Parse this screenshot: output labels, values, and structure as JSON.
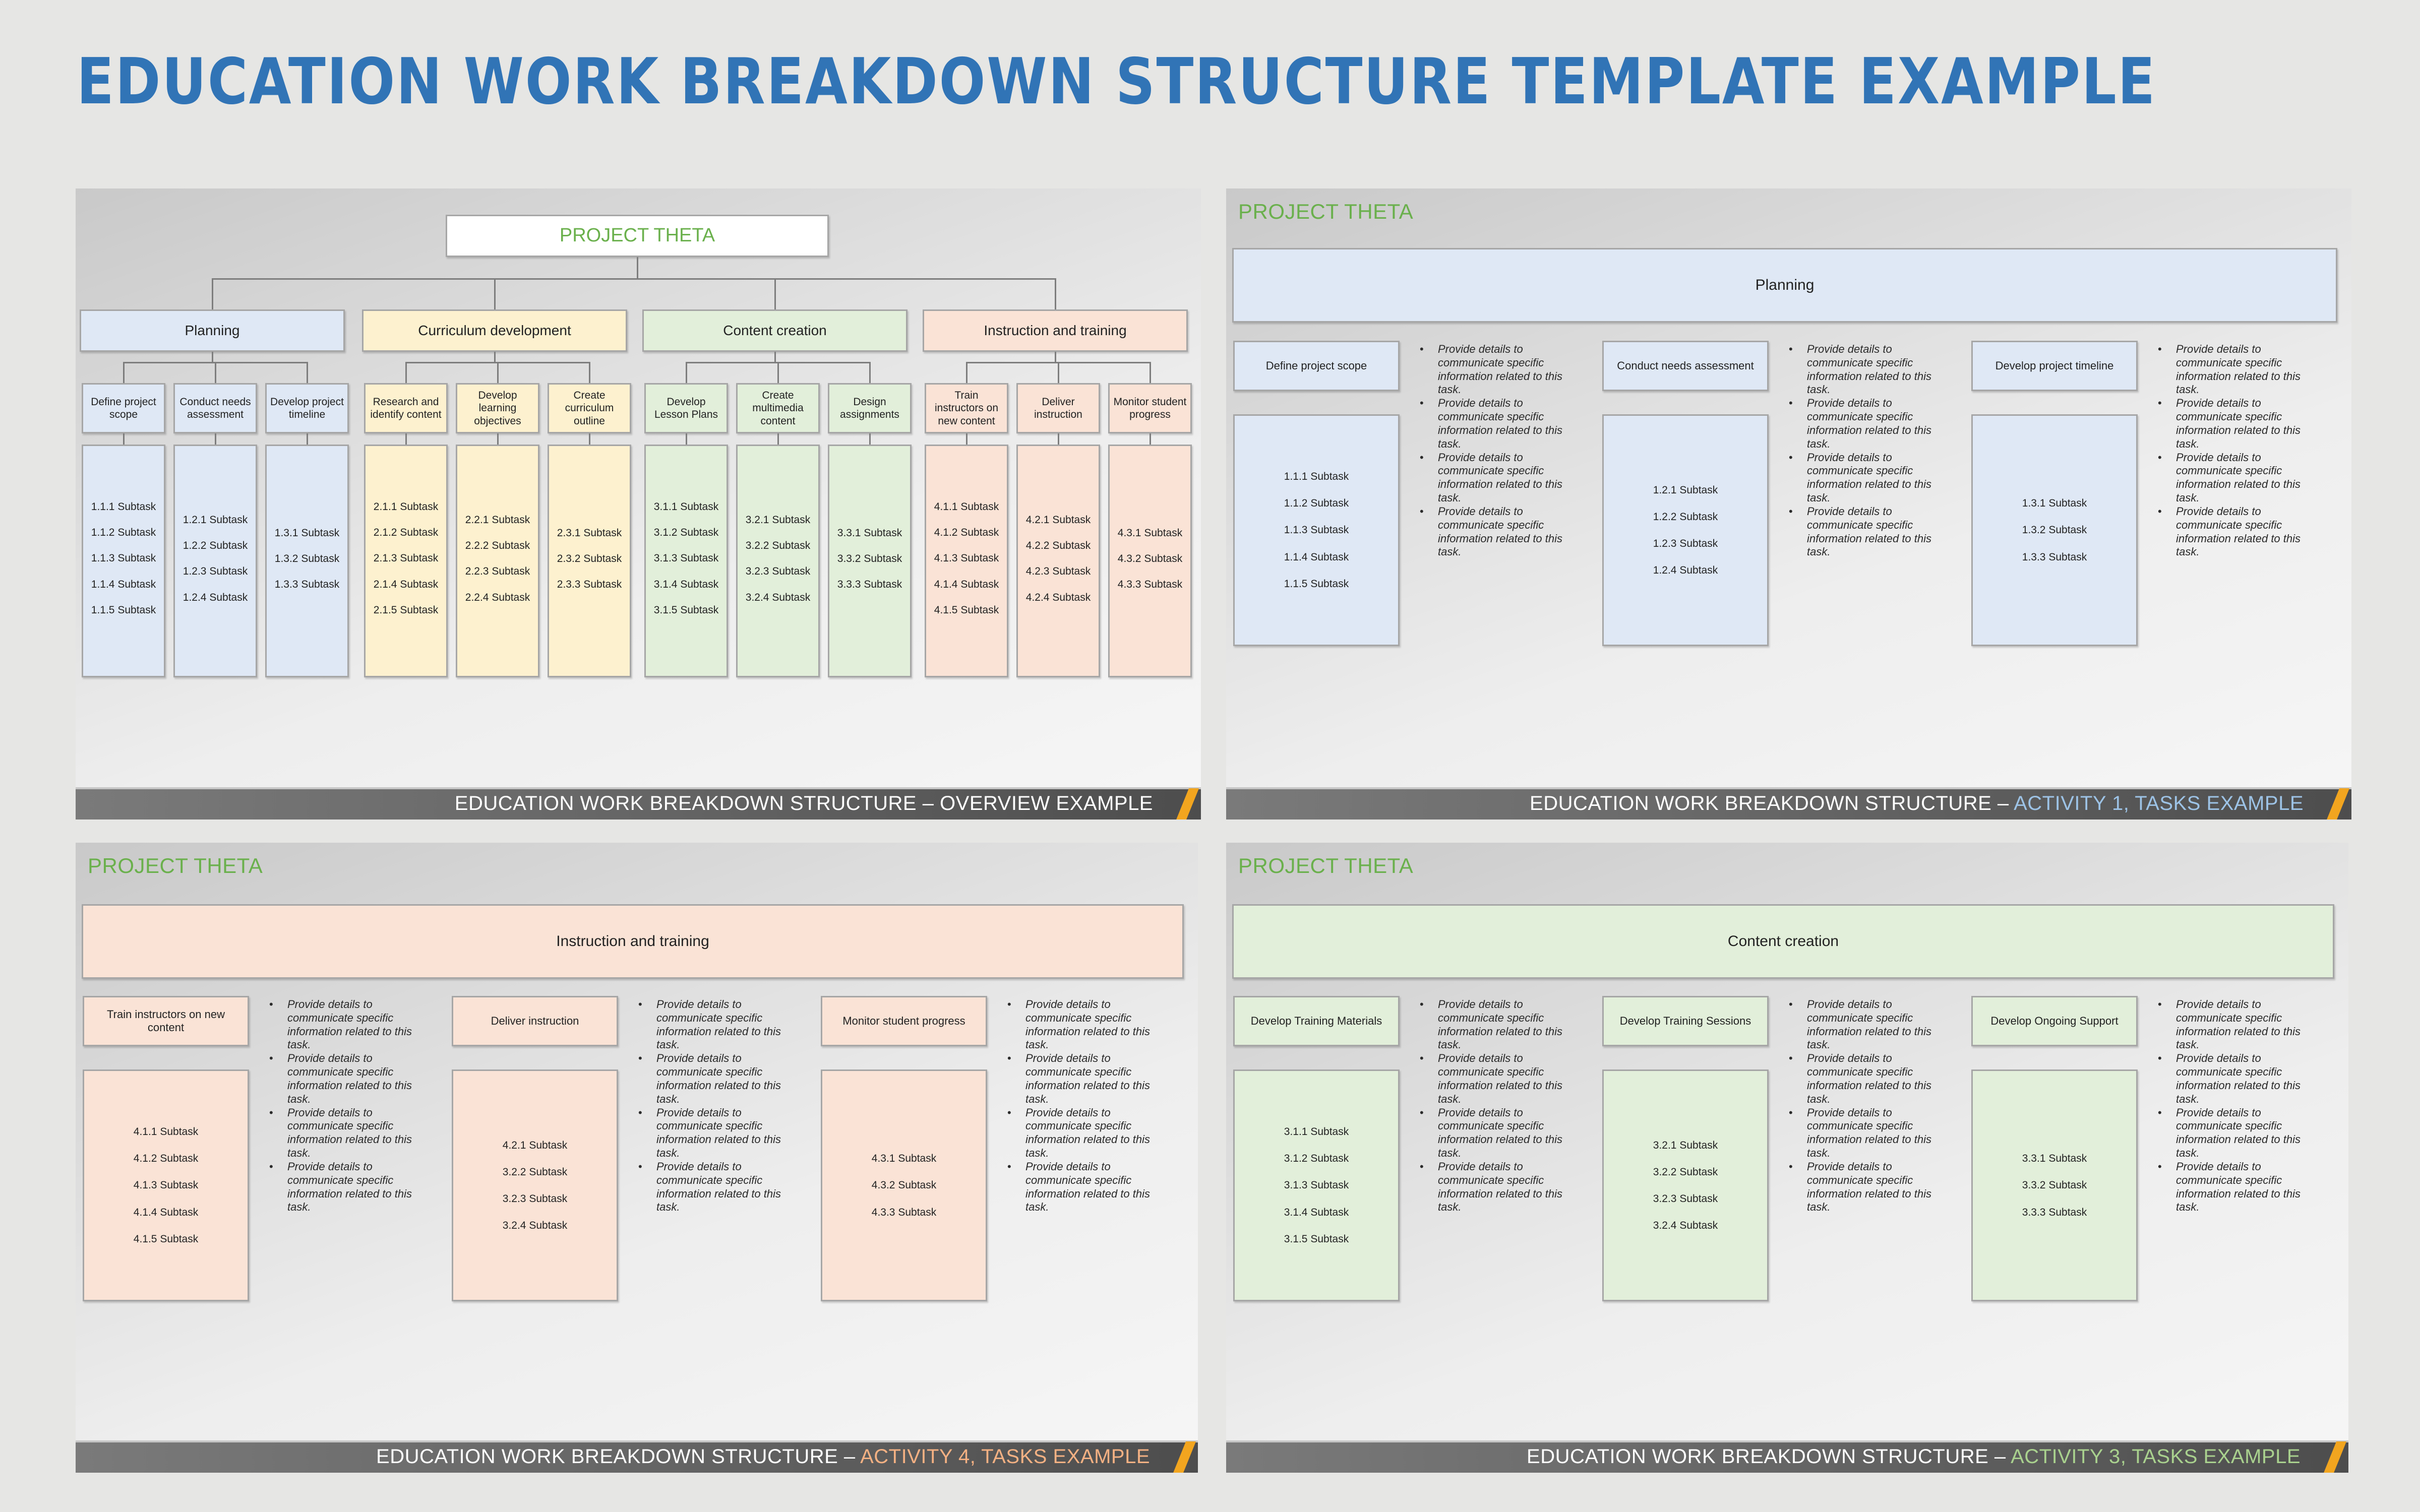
{
  "page_title": "EDUCATION WORK BREAKDOWN STRUCTURE TEMPLATE EXAMPLE",
  "colors": {
    "title_blue": "#3174b6",
    "project_green": "#6ab04c",
    "planning_blue": "#dfe8f5",
    "curriculum_yellow": "#fdf1cf",
    "content_green": "#e2efda",
    "instruction_peach": "#fae3d6",
    "footer_accent_orange": "#f2a51f",
    "activity1_footer": "#9dc3e6",
    "activity4_footer": "#f4b183",
    "activity3_footer": "#a9d18e"
  },
  "overview": {
    "project": "PROJECT THETA",
    "footer_prefix": "EDUCATION WORK BREAKDOWN STRUCTURE – ",
    "footer_highlight": "OVERVIEW EXAMPLE",
    "activities": [
      {
        "label": "Planning",
        "tasks": [
          {
            "label": "Define project scope",
            "subtasks": [
              "1.1.1 Subtask",
              "1.1.2 Subtask",
              "1.1.3 Subtask",
              "1.1.4 Subtask",
              "1.1.5 Subtask"
            ]
          },
          {
            "label": "Conduct needs assessment",
            "subtasks": [
              "1.2.1 Subtask",
              "1.2.2 Subtask",
              "1.2.3 Subtask",
              "1.2.4 Subtask"
            ]
          },
          {
            "label": "Develop project timeline",
            "subtasks": [
              "1.3.1 Subtask",
              "1.3.2 Subtask",
              "1.3.3 Subtask"
            ]
          }
        ]
      },
      {
        "label": "Curriculum development",
        "tasks": [
          {
            "label": "Research and identify content",
            "subtasks": [
              "2.1.1 Subtask",
              "2.1.2 Subtask",
              "2.1.3 Subtask",
              "2.1.4 Subtask",
              "2.1.5 Subtask"
            ]
          },
          {
            "label": "Develop learning objectives",
            "subtasks": [
              "2.2.1 Subtask",
              "2.2.2 Subtask",
              "2.2.3 Subtask",
              "2.2.4 Subtask"
            ]
          },
          {
            "label": "Create curriculum outline",
            "subtasks": [
              "2.3.1 Subtask",
              "2.3.2 Subtask",
              "2.3.3 Subtask"
            ]
          }
        ]
      },
      {
        "label": "Content creation",
        "tasks": [
          {
            "label": "Develop Lesson Plans",
            "subtasks": [
              "3.1.1 Subtask",
              "3.1.2 Subtask",
              "3.1.3 Subtask",
              "3.1.4 Subtask",
              "3.1.5 Subtask"
            ]
          },
          {
            "label": "Create multimedia content",
            "subtasks": [
              "3.2.1 Subtask",
              "3.2.2 Subtask",
              "3.2.3 Subtask",
              "3.2.4 Subtask"
            ]
          },
          {
            "label": "Design assignments",
            "subtasks": [
              "3.3.1 Subtask",
              "3.3.2 Subtask",
              "3.3.3 Subtask"
            ]
          }
        ]
      },
      {
        "label": "Instruction and training",
        "tasks": [
          {
            "label": "Train instructors on new content",
            "subtasks": [
              "4.1.1 Subtask",
              "4.1.2 Subtask",
              "4.1.3 Subtask",
              "4.1.4 Subtask",
              "4.1.5 Subtask"
            ]
          },
          {
            "label": "Deliver instruction",
            "subtasks": [
              "4.2.1 Subtask",
              "4.2.2 Subtask",
              "4.2.3 Subtask",
              "4.2.4 Subtask"
            ]
          },
          {
            "label": "Monitor student progress",
            "subtasks": [
              "4.3.1 Subtask",
              "4.3.2 Subtask",
              "4.3.3 Subtask"
            ]
          }
        ]
      }
    ]
  },
  "detail_slides": [
    {
      "project": "PROJECT THETA",
      "activity": "Planning",
      "footer_prefix": "EDUCATION WORK BREAKDOWN STRUCTURE – ",
      "footer_highlight": "ACTIVITY 1, TASKS EXAMPLE",
      "tasks": [
        {
          "label": "Define project scope",
          "subtasks": [
            "1.1.1 Subtask",
            "1.1.2 Subtask",
            "1.1.3 Subtask",
            "1.1.4 Subtask",
            "1.1.5 Subtask"
          ],
          "notes": [
            "Provide details to communicate specific information related to this task.",
            "Provide details to communicate specific information related to this task.",
            "Provide details to communicate specific information related to this task.",
            "Provide details to communicate specific information related to this task."
          ]
        },
        {
          "label": "Conduct needs assessment",
          "subtasks": [
            "1.2.1 Subtask",
            "1.2.2 Subtask",
            "1.2.3 Subtask",
            "1.2.4 Subtask"
          ],
          "notes": [
            "Provide details to communicate specific information related to this task.",
            "Provide details to communicate specific information related to this task.",
            "Provide details to communicate specific information related to this task.",
            "Provide details to communicate specific information related to this task."
          ]
        },
        {
          "label": "Develop project timeline",
          "subtasks": [
            "1.3.1 Subtask",
            "1.3.2 Subtask",
            "1.3.3 Subtask"
          ],
          "notes": [
            "Provide details to communicate specific information related to this task.",
            "Provide details to communicate specific information related to this task.",
            "Provide details to communicate specific information related to this task.",
            "Provide details to communicate specific information related to this task."
          ]
        }
      ]
    },
    {
      "project": "PROJECT THETA",
      "activity": "Instruction and training",
      "footer_prefix": "EDUCATION WORK BREAKDOWN STRUCTURE – ",
      "footer_highlight": "ACTIVITY 4, TASKS EXAMPLE",
      "tasks": [
        {
          "label": "Train instructors on new content",
          "subtasks": [
            "4.1.1 Subtask",
            "4.1.2 Subtask",
            "4.1.3 Subtask",
            "4.1.4 Subtask",
            "4.1.5 Subtask"
          ],
          "notes": [
            "Provide details to communicate specific information related to this task.",
            "Provide details to communicate specific information related to this task.",
            "Provide details to communicate specific information related to this task.",
            "Provide details to communicate specific information related to this task."
          ]
        },
        {
          "label": "Deliver instruction",
          "subtasks": [
            "4.2.1 Subtask",
            "3.2.2 Subtask",
            "3.2.3 Subtask",
            "3.2.4 Subtask"
          ],
          "notes": [
            "Provide details to communicate specific information related to this task.",
            "Provide details to communicate specific information related to this task.",
            "Provide details to communicate specific information related to this task.",
            "Provide details to communicate specific information related to this task."
          ]
        },
        {
          "label": "Monitor student progress",
          "subtasks": [
            "4.3.1 Subtask",
            "4.3.2 Subtask",
            "4.3.3 Subtask"
          ],
          "notes": [
            "Provide details to communicate specific information related to this task.",
            "Provide details to communicate specific information related to this task.",
            "Provide details to communicate specific information related to this task.",
            "Provide details to communicate specific information related to this task."
          ]
        }
      ]
    },
    {
      "project": "PROJECT THETA",
      "activity": "Content creation",
      "footer_prefix": "EDUCATION WORK BREAKDOWN STRUCTURE – ",
      "footer_highlight": "ACTIVITY 3, TASKS EXAMPLE",
      "tasks": [
        {
          "label": "Develop Training Materials",
          "subtasks": [
            "3.1.1 Subtask",
            "3.1.2 Subtask",
            "3.1.3 Subtask",
            "3.1.4 Subtask",
            "3.1.5 Subtask"
          ],
          "notes": [
            "Provide details to communicate specific information related to this task.",
            "Provide details to communicate specific information related to this task.",
            "Provide details to communicate specific information related to this task.",
            "Provide details to communicate specific information related to this task."
          ]
        },
        {
          "label": "Develop Training Sessions",
          "subtasks": [
            "3.2.1 Subtask",
            "3.2.2 Subtask",
            "3.2.3 Subtask",
            "3.2.4 Subtask"
          ],
          "notes": [
            "Provide details to communicate specific information related to this task.",
            "Provide details to communicate specific information related to this task.",
            "Provide details to communicate specific information related to this task.",
            "Provide details to communicate specific information related to this task."
          ]
        },
        {
          "label": "Develop Ongoing Support",
          "subtasks": [
            "3.3.1 Subtask",
            "3.3.2 Subtask",
            "3.3.3 Subtask"
          ],
          "notes": [
            "Provide details to communicate specific information related to this task.",
            "Provide details to communicate specific information related to this task.",
            "Provide details to communicate specific information related to this task.",
            "Provide details to communicate specific information related to this task."
          ]
        }
      ]
    }
  ]
}
